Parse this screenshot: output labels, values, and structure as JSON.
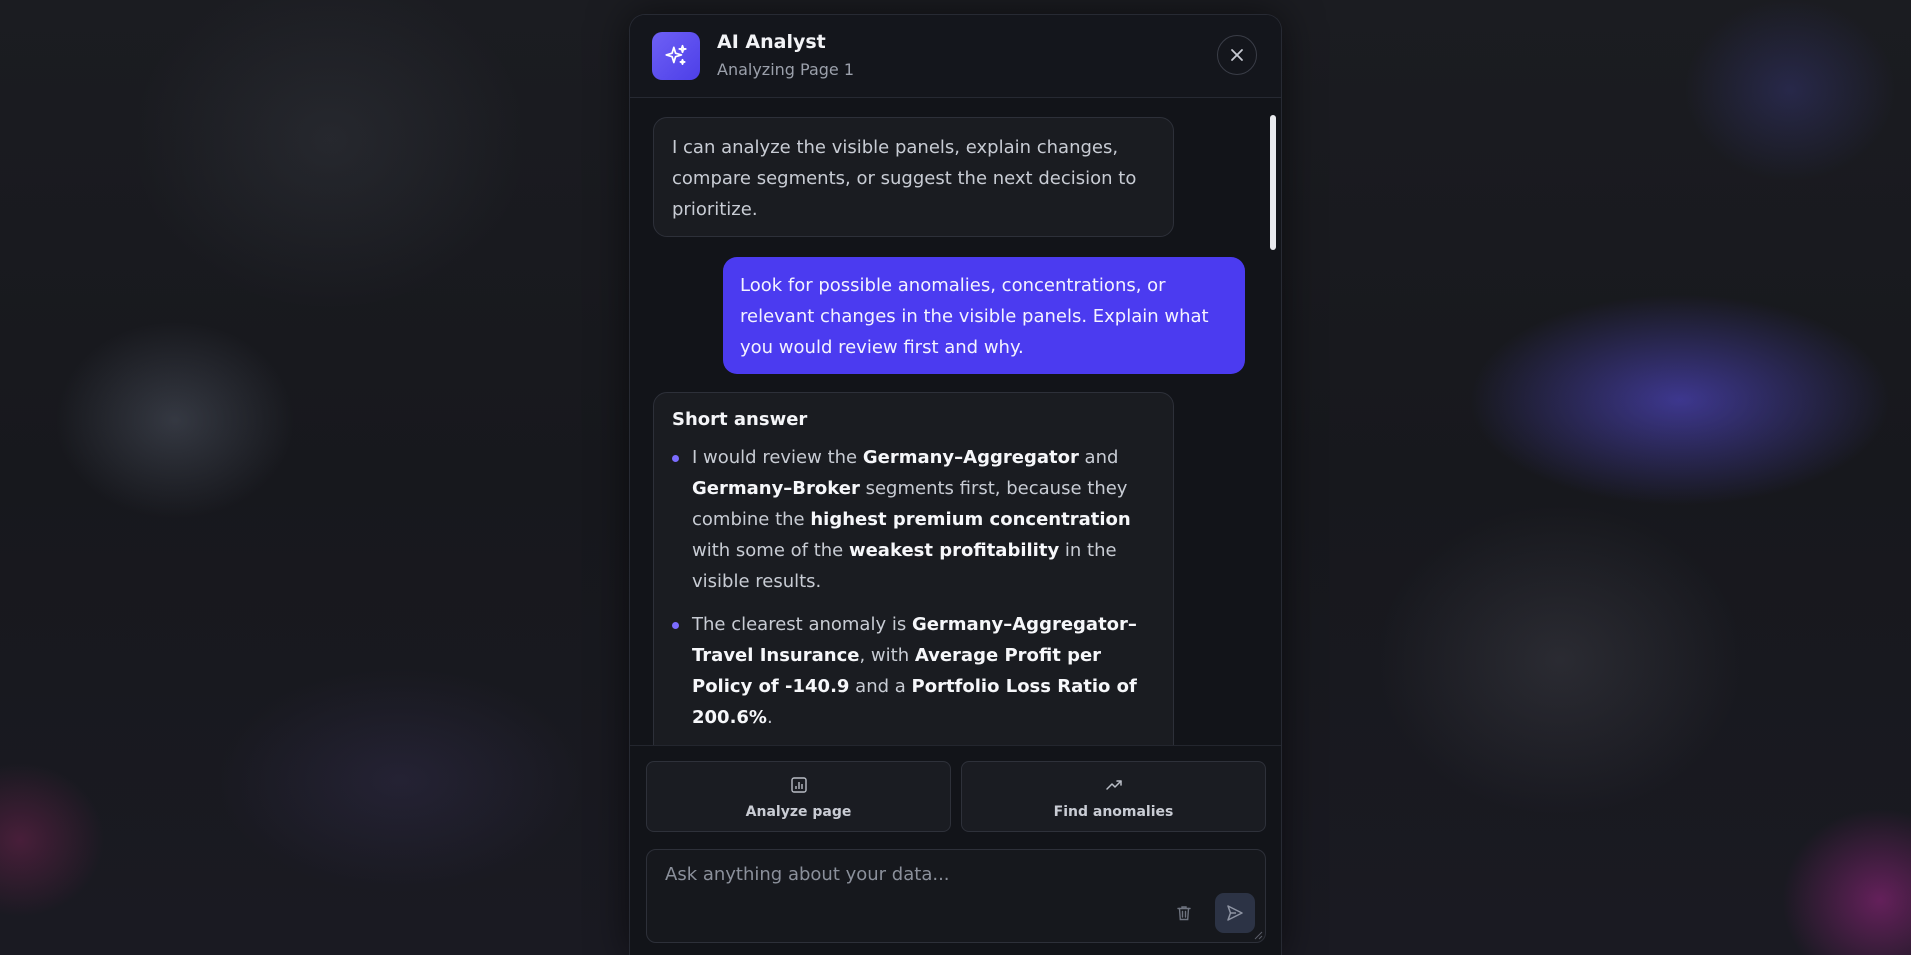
{
  "header": {
    "title": "AI Analyst",
    "subtitle": "Analyzing Page 1",
    "logo_icon": "sparkles-icon",
    "close_icon": "close-icon"
  },
  "messages": [
    {
      "role": "assistant",
      "text": "I can analyze the visible panels, explain changes, compare segments, or suggest the next decision to prioritize."
    },
    {
      "role": "user",
      "text": "Look for possible anomalies, concentrations, or relevant changes in the visible panels. Explain what you would review first and why."
    },
    {
      "role": "assistant",
      "heading": "Short answer",
      "bullets": [
        {
          "t1": "I would review the ",
          "b1": "Germany–Aggregator",
          "t2": " and ",
          "b2": "Germany–Broker",
          "t3": " segments first, because they combine the ",
          "b3": "highest premium concentration",
          "t4": " with some of the ",
          "b4": "weakest profitability",
          "t5": " in the visible results."
        },
        {
          "t1": "The clearest anomaly is ",
          "b1": "Germany–Aggregator–Travel Insurance",
          "t2": ", with ",
          "b2": "Average Profit per Policy of -140.9",
          "t3": " and a ",
          "b3": "Portfolio Loss Ratio of 200.6%",
          "t4": "."
        }
      ]
    }
  ],
  "actions": {
    "analyze_label": "Analyze page",
    "analyze_icon": "bar-chart-icon",
    "anomalies_label": "Find anomalies",
    "anomalies_icon": "trending-up-icon"
  },
  "composer": {
    "placeholder": "Ask anything about your data...",
    "value": "",
    "trash_icon": "trash-icon",
    "send_icon": "send-icon"
  },
  "colors": {
    "accent": "#4b3bf0",
    "panel_bg": "#121419",
    "bullet_dot": "#7b6cff"
  }
}
